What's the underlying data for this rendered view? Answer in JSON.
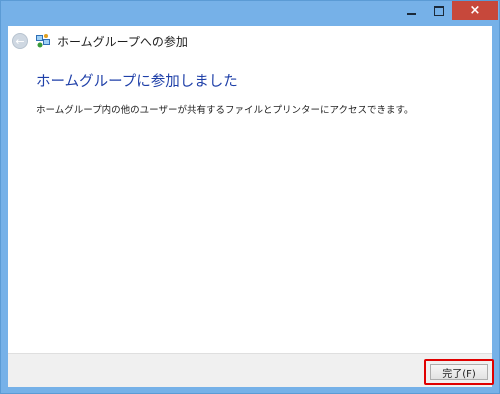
{
  "window": {
    "title": "ホームグループへの参加",
    "accent_color": "#76b1e8",
    "close_color": "#c7483b",
    "controls": {
      "minimize_icon": "minimize-icon",
      "maximize_icon": "maximize-icon",
      "close_label": "×"
    }
  },
  "nav": {
    "back_icon": "back-arrow-icon",
    "back_label": "←",
    "app_icon": "homegroup-icon"
  },
  "main": {
    "heading": "ホームグループに参加しました",
    "heading_color": "#1e3fa8",
    "description": "ホームグループ内の他のユーザーが共有するファイルとプリンターにアクセスできます。"
  },
  "footer": {
    "finish_label": "完了(F)",
    "highlight_color": "#e00000"
  }
}
